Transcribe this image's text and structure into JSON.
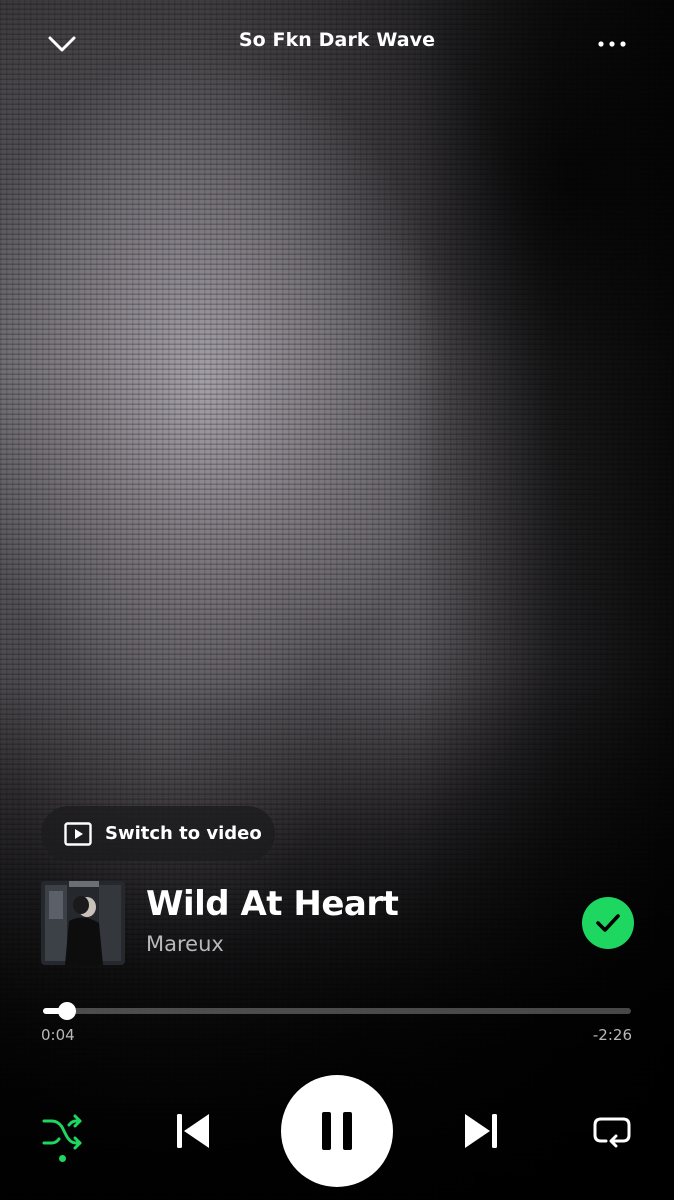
{
  "header": {
    "playlist_title": "So Fkn Dark Wave"
  },
  "switch_video": {
    "label": "Switch to video"
  },
  "track": {
    "title": "Wild At Heart",
    "artist": "Mareux",
    "liked": true
  },
  "playback": {
    "elapsed": "0:04",
    "remaining": "-2:26",
    "progress_fraction": 0.04,
    "state": "playing",
    "shuffle_on": true,
    "repeat_on": false
  },
  "colors": {
    "accent": "#1ed760",
    "text_secondary": "#b9b7ba"
  },
  "icons": {
    "collapse": "chevron-down-icon",
    "more": "more-options-icon",
    "video": "play-video-icon",
    "liked": "check-icon",
    "shuffle": "shuffle-icon",
    "previous": "skip-previous-icon",
    "pause": "pause-icon",
    "next": "skip-next-icon",
    "repeat": "repeat-icon"
  }
}
